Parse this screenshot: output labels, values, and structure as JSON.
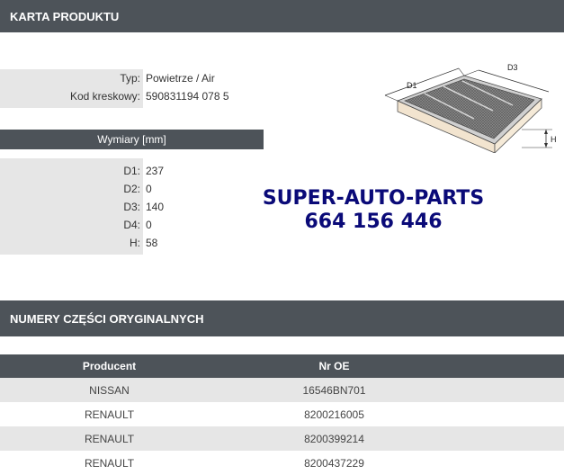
{
  "header": {
    "title": "KARTA PRODUKTU"
  },
  "product": {
    "type_label": "Typ:",
    "type_value": "Powietrze / Air",
    "barcode_label": "Kod kreskowy:",
    "barcode_value": "590831194 078 5"
  },
  "dimensions": {
    "title": "Wymiary [mm]",
    "rows": [
      {
        "label": "D1:",
        "value": "237"
      },
      {
        "label": "D2:",
        "value": "0"
      },
      {
        "label": "D3:",
        "value": "140"
      },
      {
        "label": "D4:",
        "value": "0"
      },
      {
        "label": "H:",
        "value": "58"
      }
    ]
  },
  "diagram": {
    "d1": "D1",
    "d3": "D3",
    "h": "H"
  },
  "promo": {
    "line1": "SUPER-AUTO-PARTS",
    "line2": "664 156 446"
  },
  "oe_section": {
    "title": "NUMERY CZĘŚCI ORYGINALNYCH",
    "columns": [
      "Producent",
      "Nr OE"
    ],
    "rows": [
      {
        "producer": "NISSAN",
        "oe": "16546BN701"
      },
      {
        "producer": "RENAULT",
        "oe": "8200216005"
      },
      {
        "producer": "RENAULT",
        "oe": "8200399214"
      },
      {
        "producer": "RENAULT",
        "oe": "8200437229"
      }
    ]
  },
  "colors": {
    "header_bg": "#4d5359",
    "label_bg": "#e6e6e6",
    "promo": "#0a0a78"
  }
}
